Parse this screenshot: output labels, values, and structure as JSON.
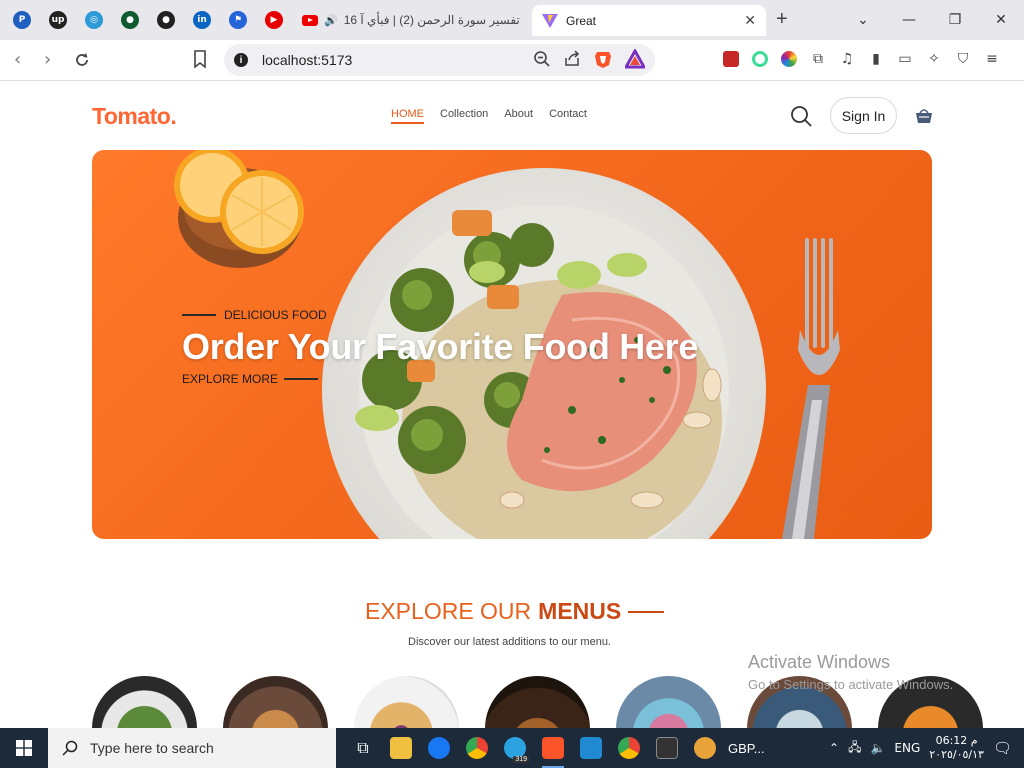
{
  "browser": {
    "pinned_tabs": [
      {
        "name": "paypal",
        "glyph": "P",
        "color": "#1f5fbf"
      },
      {
        "name": "upwork",
        "glyph": "up",
        "color": "#222222"
      },
      {
        "name": "target",
        "glyph": "◎",
        "color": "#2d9ad8"
      },
      {
        "name": "mongodb",
        "glyph": "●",
        "color": "#0f5a2e"
      },
      {
        "name": "github",
        "glyph": "●",
        "color": "#222222"
      },
      {
        "name": "linkedin",
        "glyph": "in",
        "color": "#0a66c2"
      },
      {
        "name": "bookmark-app",
        "glyph": "⚑",
        "color": "#2563d8"
      },
      {
        "name": "youtube",
        "glyph": "▶",
        "color": "#e60000"
      }
    ],
    "inactive_tab_title": "16 تفسير سورة الرحمن (2) | فبأي آ",
    "active_tab_title": "Great",
    "url": "localhost:5173"
  },
  "site": {
    "logo": "Tomato.",
    "nav": [
      {
        "label": "HOME",
        "active": true
      },
      {
        "label": "Collection",
        "active": false
      },
      {
        "label": "About",
        "active": false
      },
      {
        "label": "Contact",
        "active": false
      }
    ],
    "sign_in": "Sign In",
    "hero": {
      "tagline": "DELICIOUS FOOD",
      "headline": "Order Your Favorite Food Here",
      "explore": "EXPLORE MORE"
    },
    "section": {
      "title_normal": "EXPLORE OUR",
      "title_bold": "MENUS",
      "subtitle": "Discover our latest additions to our menu."
    },
    "menu_items_count": 7
  },
  "watermark": {
    "line1": "Activate Windows",
    "line2": "Go to Settings to activate Windows."
  },
  "taskbar": {
    "search_placeholder": "Type here to search",
    "telegram_badge": "319",
    "gbp_label": "GBP...",
    "lang": "ENG",
    "time": "06:12 م",
    "date": "٢٠٢٥/٠٥/١٣"
  }
}
